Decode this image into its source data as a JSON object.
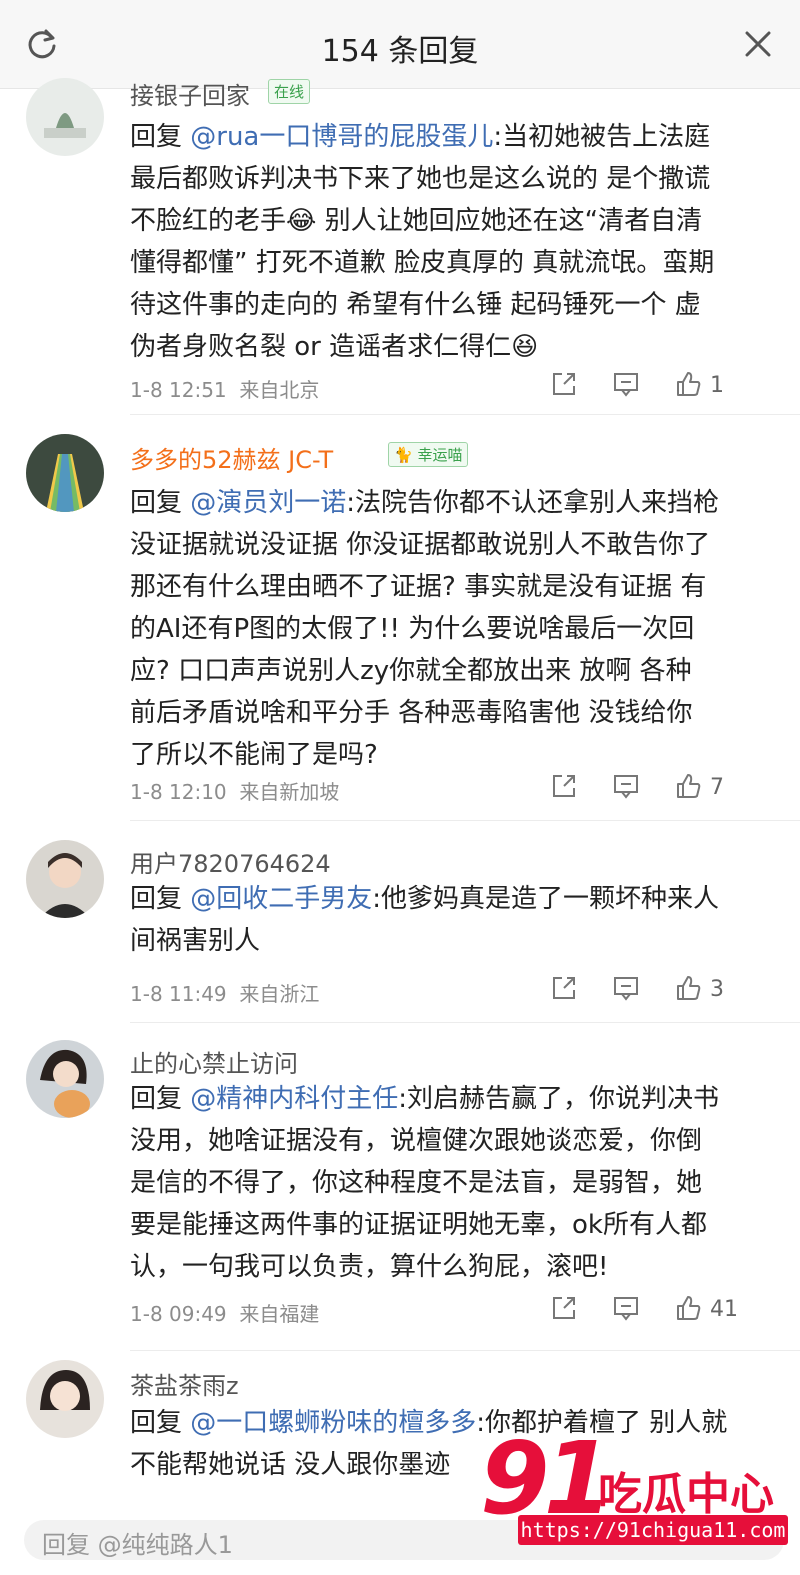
{
  "header": {
    "title": "154 条回复"
  },
  "comments": [
    {
      "username": "接银子回家",
      "badge": "在线",
      "vip": false,
      "mention": "@rua一口博哥的屁股蛋儿",
      "lines": [
        "回复 @rua一口博哥的屁股蛋儿:当初她被告上法庭",
        "最后都败诉判决书下来了她也是这么说的 是个撒谎",
        "不脸红的老手😂  别人让她回应她还在这“清者自清",
        "懂得都懂” 打死不道歉  脸皮真厚的 真就流氓。蛮期",
        "待这件事的走向的 希望有什么锤 起码锤死一个 虚",
        "伪者身败名裂 or 造谣者求仁得仁😆"
      ],
      "time": "1-8 12:51",
      "location": "来自北京",
      "likes": "1"
    },
    {
      "username": "多多的52赫兹 JC-T",
      "badge": "幸运喵",
      "vip": true,
      "mention": "@演员刘一诺",
      "lines": [
        "回复 @演员刘一诺:法院告你都不认还拿别人来挡枪",
        "没证据就说没证据  你没证据都敢说别人不敢告你了",
        "那还有什么理由晒不了证据? 事实就是没有证据  有",
        "的AI还有P图的太假了!! 为什么要说啥最后一次回",
        "应? 口口声声说别人zy你就全都放出来  放啊  各种",
        "前后矛盾说啥和平分手  各种恶毒陷害他  没钱给你",
        "了所以不能闹了是吗?"
      ],
      "time": "1-8 12:10",
      "location": "来自新加坡",
      "likes": "7"
    },
    {
      "username": "用户7820764624",
      "badge": "",
      "vip": false,
      "mention": "@回收二手男友",
      "lines": [
        "回复 @回收二手男友:他爹妈真是造了一颗坏种来人",
        "间祸害别人"
      ],
      "time": "1-8 11:49",
      "location": "来自浙江",
      "likes": "3"
    },
    {
      "username": "止的心禁止访问",
      "badge": "",
      "vip": false,
      "mention": "@精神内科付主任",
      "lines": [
        "回复 @精神内科付主任:刘启赫告赢了，你说判决书",
        "没用，她啥证据没有，说檀健次跟她谈恋爱，你倒",
        "是信的不得了，你这种程度不是法盲，是弱智，她",
        "要是能捶这两件事的证据证明她无辜，ok所有人都",
        "认，一句我可以负责，算什么狗屁，滚吧!"
      ],
      "time": "1-8 09:49",
      "location": "来自福建",
      "likes": "41"
    },
    {
      "username": "茶盐茶雨z",
      "badge": "",
      "vip": false,
      "mention": "@一口螺蛳粉味的檀多多",
      "lines": [
        "回复 @一口螺蛳粉味的檀多多:你都护着檀了 别人就",
        "不能帮她说话 没人跟你墨迹"
      ],
      "time": "",
      "location": "",
      "likes": ""
    }
  ],
  "reply_bar": {
    "placeholder": "回复 @纯纯路人1"
  },
  "watermark": {
    "number": "91",
    "brand": "吃瓜中心",
    "url": "https://91chigua11.com"
  },
  "icons": {
    "refresh": "refresh-icon",
    "close": "close-icon",
    "share": "share-icon",
    "comment": "comment-icon",
    "like": "like-icon"
  },
  "colors": {
    "mention": "#3f6db3",
    "vip_name": "#f36f1a",
    "watermark": "#e60f3a"
  }
}
